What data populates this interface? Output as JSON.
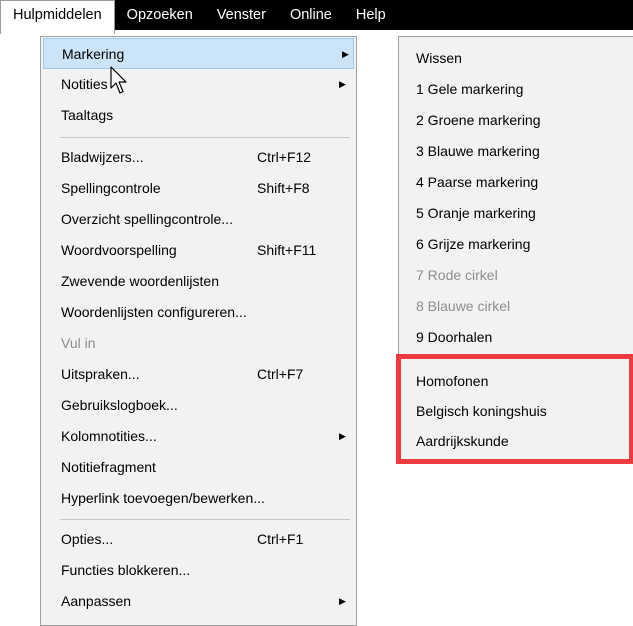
{
  "menubar": {
    "items": [
      "Hulpmiddelen",
      "Opzoeken",
      "Venster",
      "Online",
      "Help"
    ]
  },
  "menu": {
    "items": [
      {
        "label": "Markering",
        "shortcut": "",
        "submenu": true,
        "state": "highlighted"
      },
      {
        "label": "Notities",
        "shortcut": "",
        "submenu": true,
        "state": "normal"
      },
      {
        "label": "Taaltags",
        "shortcut": "",
        "submenu": false,
        "state": "normal"
      },
      {
        "label": "Bladwijzers...",
        "shortcut": "Ctrl+F12",
        "submenu": false,
        "state": "normal"
      },
      {
        "label": "Spellingcontrole",
        "shortcut": "Shift+F8",
        "submenu": false,
        "state": "normal"
      },
      {
        "label": "Overzicht spellingcontrole...",
        "shortcut": "",
        "submenu": false,
        "state": "normal"
      },
      {
        "label": "Woordvoorspelling",
        "shortcut": "Shift+F11",
        "submenu": false,
        "state": "normal"
      },
      {
        "label": "Zwevende woordenlijsten",
        "shortcut": "",
        "submenu": false,
        "state": "normal"
      },
      {
        "label": "Woordenlijsten configureren...",
        "shortcut": "",
        "submenu": false,
        "state": "normal"
      },
      {
        "label": "Vul in",
        "shortcut": "",
        "submenu": false,
        "state": "disabled"
      },
      {
        "label": "Uitspraken...",
        "shortcut": "Ctrl+F7",
        "submenu": false,
        "state": "normal"
      },
      {
        "label": "Gebruikslogboek...",
        "shortcut": "",
        "submenu": false,
        "state": "normal"
      },
      {
        "label": "Kolomnotities...",
        "shortcut": "",
        "submenu": true,
        "state": "normal"
      },
      {
        "label": "Notitiefragment",
        "shortcut": "",
        "submenu": false,
        "state": "normal"
      },
      {
        "label": "Hyperlink toevoegen/bewerken...",
        "shortcut": "",
        "submenu": false,
        "state": "normal"
      },
      {
        "label": "Opties...",
        "shortcut": "Ctrl+F1",
        "submenu": false,
        "state": "normal"
      },
      {
        "label": "Functies blokkeren...",
        "shortcut": "",
        "submenu": false,
        "state": "normal"
      },
      {
        "label": "Aanpassen",
        "shortcut": "",
        "submenu": true,
        "state": "normal"
      }
    ]
  },
  "submenu": {
    "items": [
      {
        "label": "Wissen",
        "state": "normal"
      },
      {
        "label": "1 Gele markering",
        "state": "normal"
      },
      {
        "label": "2 Groene markering",
        "state": "normal"
      },
      {
        "label": "3 Blauwe markering",
        "state": "normal"
      },
      {
        "label": "4 Paarse markering",
        "state": "normal"
      },
      {
        "label": "5 Oranje markering",
        "state": "normal"
      },
      {
        "label": "6 Grijze markering",
        "state": "normal"
      },
      {
        "label": "7 Rode cirkel",
        "state": "disabled"
      },
      {
        "label": "8 Blauwe cirkel",
        "state": "disabled"
      },
      {
        "label": "9 Doorhalen",
        "state": "normal"
      },
      {
        "label": "Homofonen",
        "state": "normal"
      },
      {
        "label": "Belgisch koningshuis",
        "state": "normal"
      },
      {
        "label": "Aardrijkskunde",
        "state": "normal"
      }
    ]
  },
  "colors": {
    "annotation_box": "#ef3a40",
    "highlight": "#cce4f7",
    "menu_background": "#f2f2f2",
    "menubar_background": "#000000"
  }
}
